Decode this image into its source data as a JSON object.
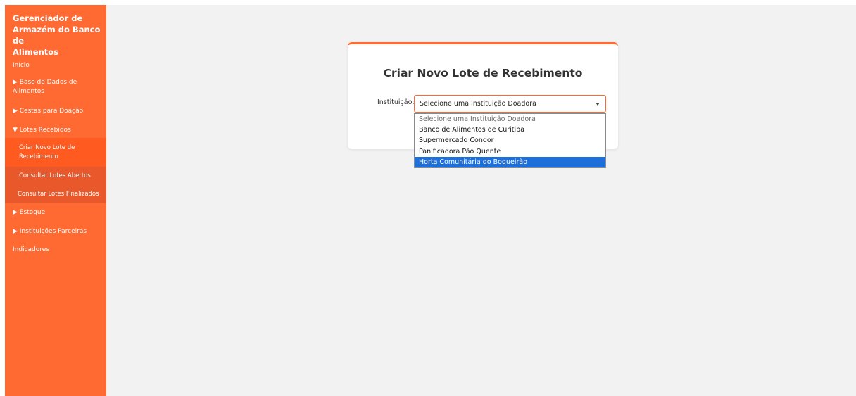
{
  "sidebar": {
    "brand_line1": "Gerenciador de",
    "brand_line2": "Armazém do Banco de",
    "brand_line3": "Alimentos",
    "items": {
      "inicio": "Início",
      "base_line1": "▶ Base de Dados de",
      "base_line2": "Alimentos",
      "cestas": "▶ Cestas para Doação",
      "lotes": "▼ Lotes Recebidos",
      "criar_line1": "Criar Novo Lote de",
      "criar_line2": "Recebimento",
      "consultar_abertos": "Consultar Lotes Abertos",
      "consultar_finalizados": "Consultar Lotes Finalizados",
      "estoque": "▶ Estoque",
      "instituicoes": "▶ Instituições Parceiras",
      "indicadores": "Indicadores"
    }
  },
  "main": {
    "card_title": "Criar Novo Lote de Recebimento",
    "institution_label": "Instituição:",
    "select_value": "Selecione uma Instituição Doadora",
    "options": [
      "Selecione uma Instituição Doadora",
      "Banco de Alimentos de Curitiba",
      "Supermercado Condor",
      "Panificadora Pão Quente",
      "Horta Comunitária do Boqueirão"
    ]
  },
  "colors": {
    "sidebar_bg": "#ff6a33",
    "accent": "#ff6a33",
    "selected_option": "#1e6fd9"
  }
}
